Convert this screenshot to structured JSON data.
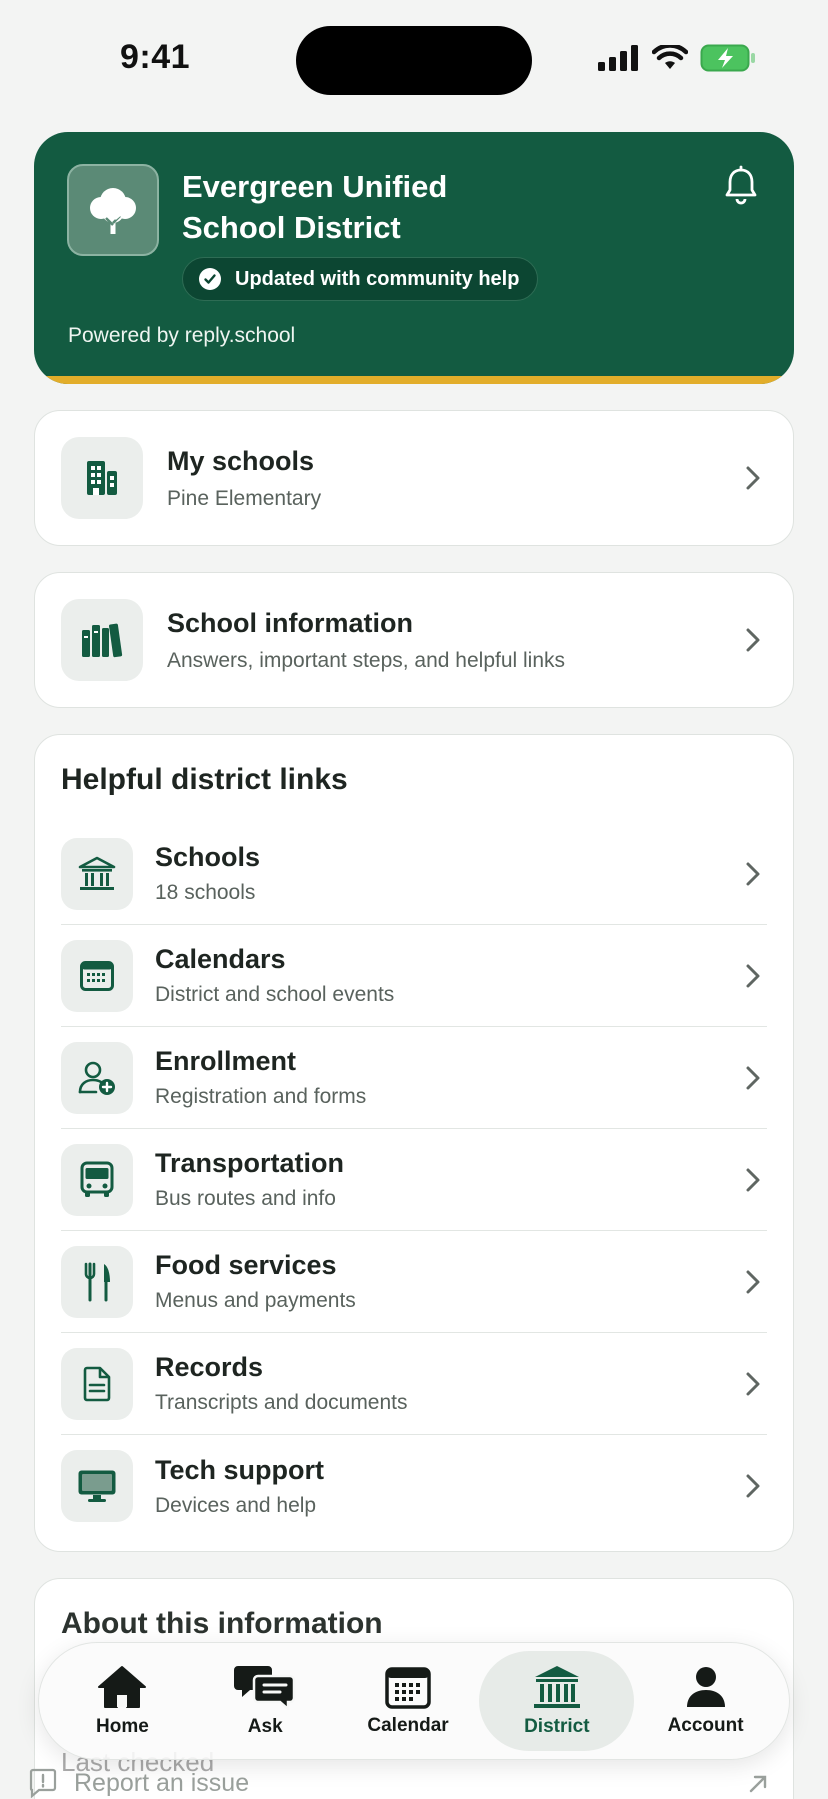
{
  "status_bar": {
    "time": "9:41"
  },
  "header": {
    "district_name_line1": "Evergreen Unified",
    "district_name_line2": "School District",
    "badge": "Updated with community help",
    "powered_by": "Powered by reply.school",
    "colors": {
      "brand": "#135b41",
      "accent": "#e2ad2a"
    },
    "icons": {
      "logo": "tree-icon",
      "notifications": "bell-icon"
    }
  },
  "my_schools": {
    "title": "My schools",
    "subtitle": "Pine Elementary",
    "icon": "building-icon"
  },
  "school_info": {
    "title": "School information",
    "subtitle": "Answers, important steps, and helpful links",
    "icon": "books-icon"
  },
  "links": {
    "heading": "Helpful district links",
    "items": [
      {
        "title": "Schools",
        "subtitle": "18 schools",
        "icon": "school-building-icon"
      },
      {
        "title": "Calendars",
        "subtitle": "District and school events",
        "icon": "calendar-icon"
      },
      {
        "title": "Enrollment",
        "subtitle": "Registration and forms",
        "icon": "user-add-icon"
      },
      {
        "title": "Transportation",
        "subtitle": "Bus routes and info",
        "icon": "bus-icon"
      },
      {
        "title": "Food services",
        "subtitle": "Menus and payments",
        "icon": "fork-knife-icon"
      },
      {
        "title": "Records",
        "subtitle": "Transcripts and documents",
        "icon": "document-icon"
      },
      {
        "title": "Tech support",
        "subtitle": "Devices and help",
        "icon": "monitor-icon"
      }
    ]
  },
  "about": {
    "heading": "About this information",
    "line1": "Last checked",
    "report": "Report an issue"
  },
  "tabs": [
    {
      "label": "Home",
      "icon": "home-icon",
      "active": false
    },
    {
      "label": "Ask",
      "icon": "chat-icon",
      "active": false
    },
    {
      "label": "Calendar",
      "icon": "calendar-icon",
      "active": false
    },
    {
      "label": "District",
      "icon": "district-icon",
      "active": true
    },
    {
      "label": "Account",
      "icon": "person-icon",
      "active": false
    }
  ]
}
